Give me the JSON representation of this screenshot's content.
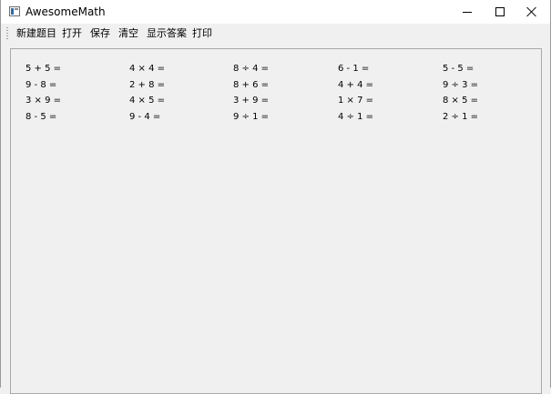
{
  "window": {
    "title": "AwesomeMath",
    "icon": "app-window-icon",
    "controls": {
      "minimize": "minimize-icon",
      "maximize": "maximize-icon",
      "close": "close-icon"
    }
  },
  "toolbar": {
    "items": [
      {
        "id": "new",
        "label": "新建题目"
      },
      {
        "id": "open",
        "label": "打开"
      },
      {
        "id": "save",
        "label": "保存"
      },
      {
        "id": "clear",
        "label": "清空"
      },
      {
        "id": "show-answers",
        "label": "显示答案"
      },
      {
        "id": "print",
        "label": "打印"
      }
    ]
  },
  "problems": {
    "rows": [
      [
        "5 + 5 =",
        "4 × 4 =",
        "8 ÷ 4 =",
        "6 - 1 =",
        "5 - 5 ="
      ],
      [
        "9 - 8 =",
        "2 + 8 =",
        "8 + 6 =",
        "4 + 4 =",
        "9 ÷ 3 ="
      ],
      [
        "3 × 9 =",
        "4 × 5 =",
        "3 + 9 =",
        "1 × 7 =",
        "8 × 5 ="
      ],
      [
        "8 - 5 =",
        "9 - 4 =",
        "9 ÷ 1 =",
        "4 ÷ 1 =",
        "2 ÷ 1 ="
      ]
    ]
  }
}
